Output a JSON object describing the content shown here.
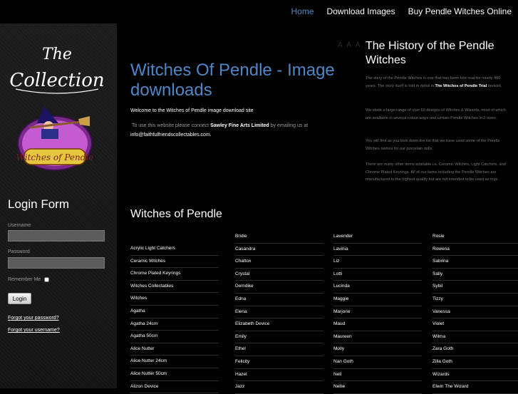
{
  "topnav": {
    "items": [
      {
        "label": "Home",
        "active": true
      },
      {
        "label": "Download Images",
        "active": false
      },
      {
        "label": "Buy Pendle Witches Online",
        "active": false
      }
    ]
  },
  "sidebar": {
    "logo_text": "The Collection",
    "badge_text": "Witches of Pendle",
    "login": {
      "title": "Login Form",
      "username_label": "Username",
      "password_label": "Password",
      "remember_label": "Remember Me",
      "login_button": "Login",
      "forgot_password": "Forgot your password?",
      "forgot_username": "Forgot your username?"
    }
  },
  "main": {
    "text_size": "A A A",
    "title": "Witches Of Pendle - Image downloads",
    "welcome": "Welcome to the Witches of Pendle image download site",
    "contact_pre": "To use this website please connect",
    "contact_company": "Sawley Fine Arts Limited",
    "contact_mid": "by emailing us at",
    "contact_email": "info@faithfulfriendscollectables.com",
    "contact_end": "."
  },
  "history": {
    "title": "The History of the Pendle Witches",
    "p1_pre": "The story of the Pendle Witches is one that has been told now for nearly 400 years. The story itself is told in detail in",
    "p1_bold": "The Witches of Pendle Trial",
    "p1_post": "booklet.",
    "p2": "We stock a large range of over 50 designs of Witches & Wizards, most of which are available in several colour ways and certain Pendle Witches in 2 sizes.",
    "p3": "You will find as you look down the list that we have used some of the Pendle Witches names for our porcelain dolls.",
    "p4": "There are many other items available i.e. Ceramic Witches, Light Catchers, and Chrome Plated Keyrings. All of our items including the Pendle Witches are manufactured to the highest quality but are not intended to be used as toys."
  },
  "witches": {
    "title": "Witches of Pendle",
    "columns": [
      [
        "Acrylic Light Catchers",
        "Ceramic Witches",
        "Chrome Plated Keyrings",
        "Witches Collectables",
        "Witches",
        "Agatha",
        "Agatha 24cm",
        "Agatha 50cm",
        "Alice Nutter",
        "Alice Nutter 24cm",
        "Alice Nutter 50cm",
        "Alizon Device"
      ],
      [
        "Bridie",
        "Casandra",
        "Chattox",
        "Crystal",
        "Demdike",
        "Edna",
        "Elena",
        "Elizabeth Device",
        "Emily",
        "Ethel",
        "Felicity",
        "Hazel",
        "Jazz"
      ],
      [
        "Lavender",
        "Lavinia",
        "Liz",
        "Lotti",
        "Lucinda",
        "Maggie",
        "Marjorie",
        "Maud",
        "Maureen",
        "Molly",
        "Nan Goth",
        "Nell",
        "Nellie"
      ],
      [
        "Rosie",
        "Rowena",
        "Sabrina",
        "Sally",
        "Sybil",
        "Tizzy",
        "Vanessa",
        "Violet",
        "Wilma",
        "Zara Goth",
        "Zilla Goth",
        "Wizards",
        "Elwin The Wizard"
      ]
    ]
  },
  "colors": {
    "accent": "#4f87c6",
    "background": "#000000",
    "sidebar": "#1a1a1a"
  }
}
